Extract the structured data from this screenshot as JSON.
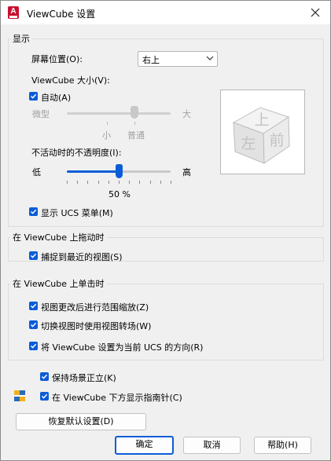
{
  "window": {
    "title": "ViewCube 设置",
    "icon_letter": "A"
  },
  "display": {
    "group_label": "显示",
    "screen_position_label": "屏幕位置(O):",
    "screen_position_value": "右上",
    "size_label": "ViewCube 大小(V):",
    "auto_label": "自动(A)",
    "auto_checked": true,
    "size_min_label": "微型",
    "size_max_label": "大",
    "size_tick_small": "小",
    "size_tick_normal": "普通",
    "opacity_label": "不活动时的不透明度(I):",
    "opacity_min_label": "低",
    "opacity_max_label": "高",
    "opacity_value": "50 %",
    "opacity_fraction": 0.5,
    "show_ucs_menu_label": "显示 UCS 菜单(M)",
    "show_ucs_menu_checked": true,
    "cube_faces": {
      "top": "上",
      "left": "左",
      "front": "前"
    }
  },
  "drag": {
    "group_label": "在 ViewCube 上拖动时",
    "snap_label": "捕捉到最近的视图(S)",
    "snap_checked": true
  },
  "click": {
    "group_label": "在 ViewCube 上单击时",
    "zoom_extents_label": "视图更改后进行范围缩放(Z)",
    "transitions_label": "切换视图时使用视图转场(W)",
    "set_ucs_label": "将 ViewCube 设置为当前 UCS 的方向(R)"
  },
  "bottom": {
    "keep_upright_label": "保持场景正立(K)",
    "show_compass_label": "在 ViewCube 下方显示指南针(C)",
    "restore_defaults_label": "恢复默认设置(D)"
  },
  "buttons": {
    "ok": "确定",
    "cancel": "取消",
    "help": "帮助(H)"
  },
  "colors": {
    "accent": "#0b5cd7",
    "app_icon": "#c8102e"
  }
}
